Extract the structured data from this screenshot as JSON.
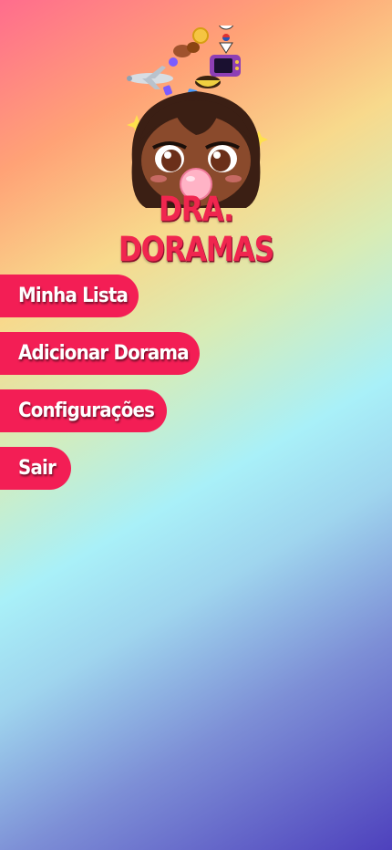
{
  "logo": {
    "text": "DRA. DORAMAS",
    "icon": "cartoon-girl-logo"
  },
  "menu": {
    "items": [
      {
        "label": "Minha Lista"
      },
      {
        "label": "Adicionar Dorama"
      },
      {
        "label": "Configurações"
      },
      {
        "label": "Sair"
      }
    ]
  },
  "colors": {
    "button": "#f31e55",
    "logo_text": "#f0264f",
    "gradient": [
      "#ff6d8d",
      "#f8d98c",
      "#a9f0f8",
      "#4e41bd"
    ]
  }
}
